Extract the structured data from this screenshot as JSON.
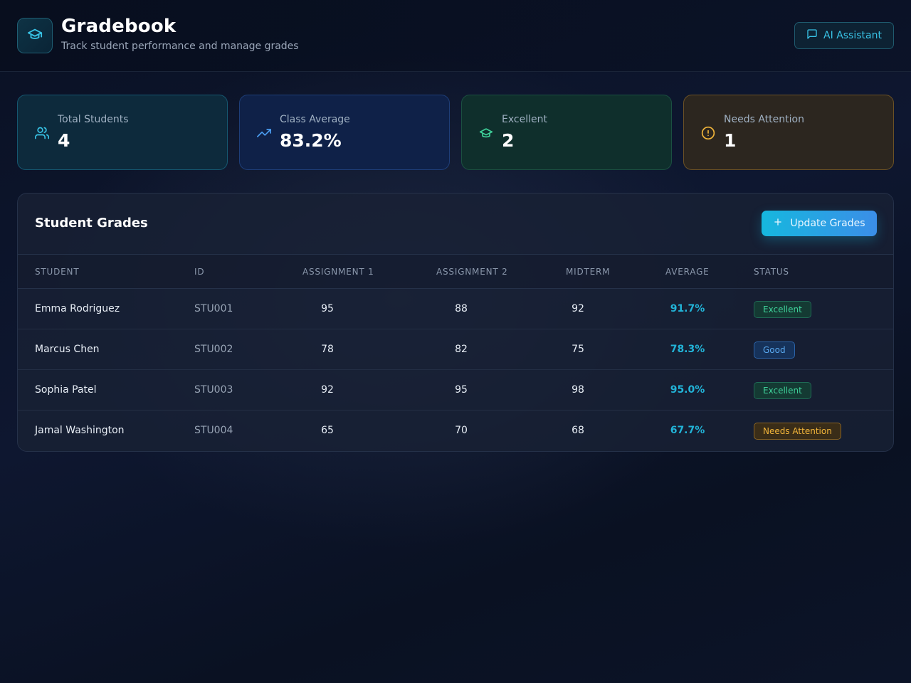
{
  "header": {
    "title": "Gradebook",
    "subtitle": "Track student performance and manage grades",
    "logo_icon": "graduation-cap-icon",
    "ai_button": {
      "label": "AI Assistant",
      "icon": "message-square-icon"
    }
  },
  "stats": [
    {
      "label": "Total Students",
      "value": "4",
      "icon": "users-icon",
      "color": "#38c3e6"
    },
    {
      "label": "Class Average",
      "value": "83.2%",
      "icon": "trending-up-icon",
      "color": "#4a9cf0"
    },
    {
      "label": "Excellent",
      "value": "2",
      "icon": "graduation-cap-icon",
      "color": "#3fd29b"
    },
    {
      "label": "Needs Attention",
      "value": "1",
      "icon": "alert-circle-icon",
      "color": "#f2b53a"
    }
  ],
  "grades": {
    "title": "Student Grades",
    "update_button": {
      "label": "Update Grades",
      "icon": "plus-icon"
    },
    "columns": [
      "STUDENT",
      "ID",
      "ASSIGNMENT 1",
      "ASSIGNMENT 2",
      "MIDTERM",
      "AVERAGE",
      "STATUS"
    ],
    "rows": [
      {
        "student": "Emma Rodriguez",
        "id": "STU001",
        "a1": "95",
        "a2": "88",
        "midterm": "92",
        "average": "91.7%",
        "status": "Excellent"
      },
      {
        "student": "Marcus Chen",
        "id": "STU002",
        "a1": "78",
        "a2": "82",
        "midterm": "75",
        "average": "78.3%",
        "status": "Good"
      },
      {
        "student": "Sophia Patel",
        "id": "STU003",
        "a1": "92",
        "a2": "95",
        "midterm": "98",
        "average": "95.0%",
        "status": "Excellent"
      },
      {
        "student": "Jamal Washington",
        "id": "STU004",
        "a1": "65",
        "a2": "70",
        "midterm": "68",
        "average": "67.7%",
        "status": "Needs Attention"
      }
    ]
  },
  "colors": {
    "accent": "#22b4d8",
    "excellent": "#3fd29b",
    "good": "#5aa9f0",
    "needs_attention": "#f2b53a"
  }
}
